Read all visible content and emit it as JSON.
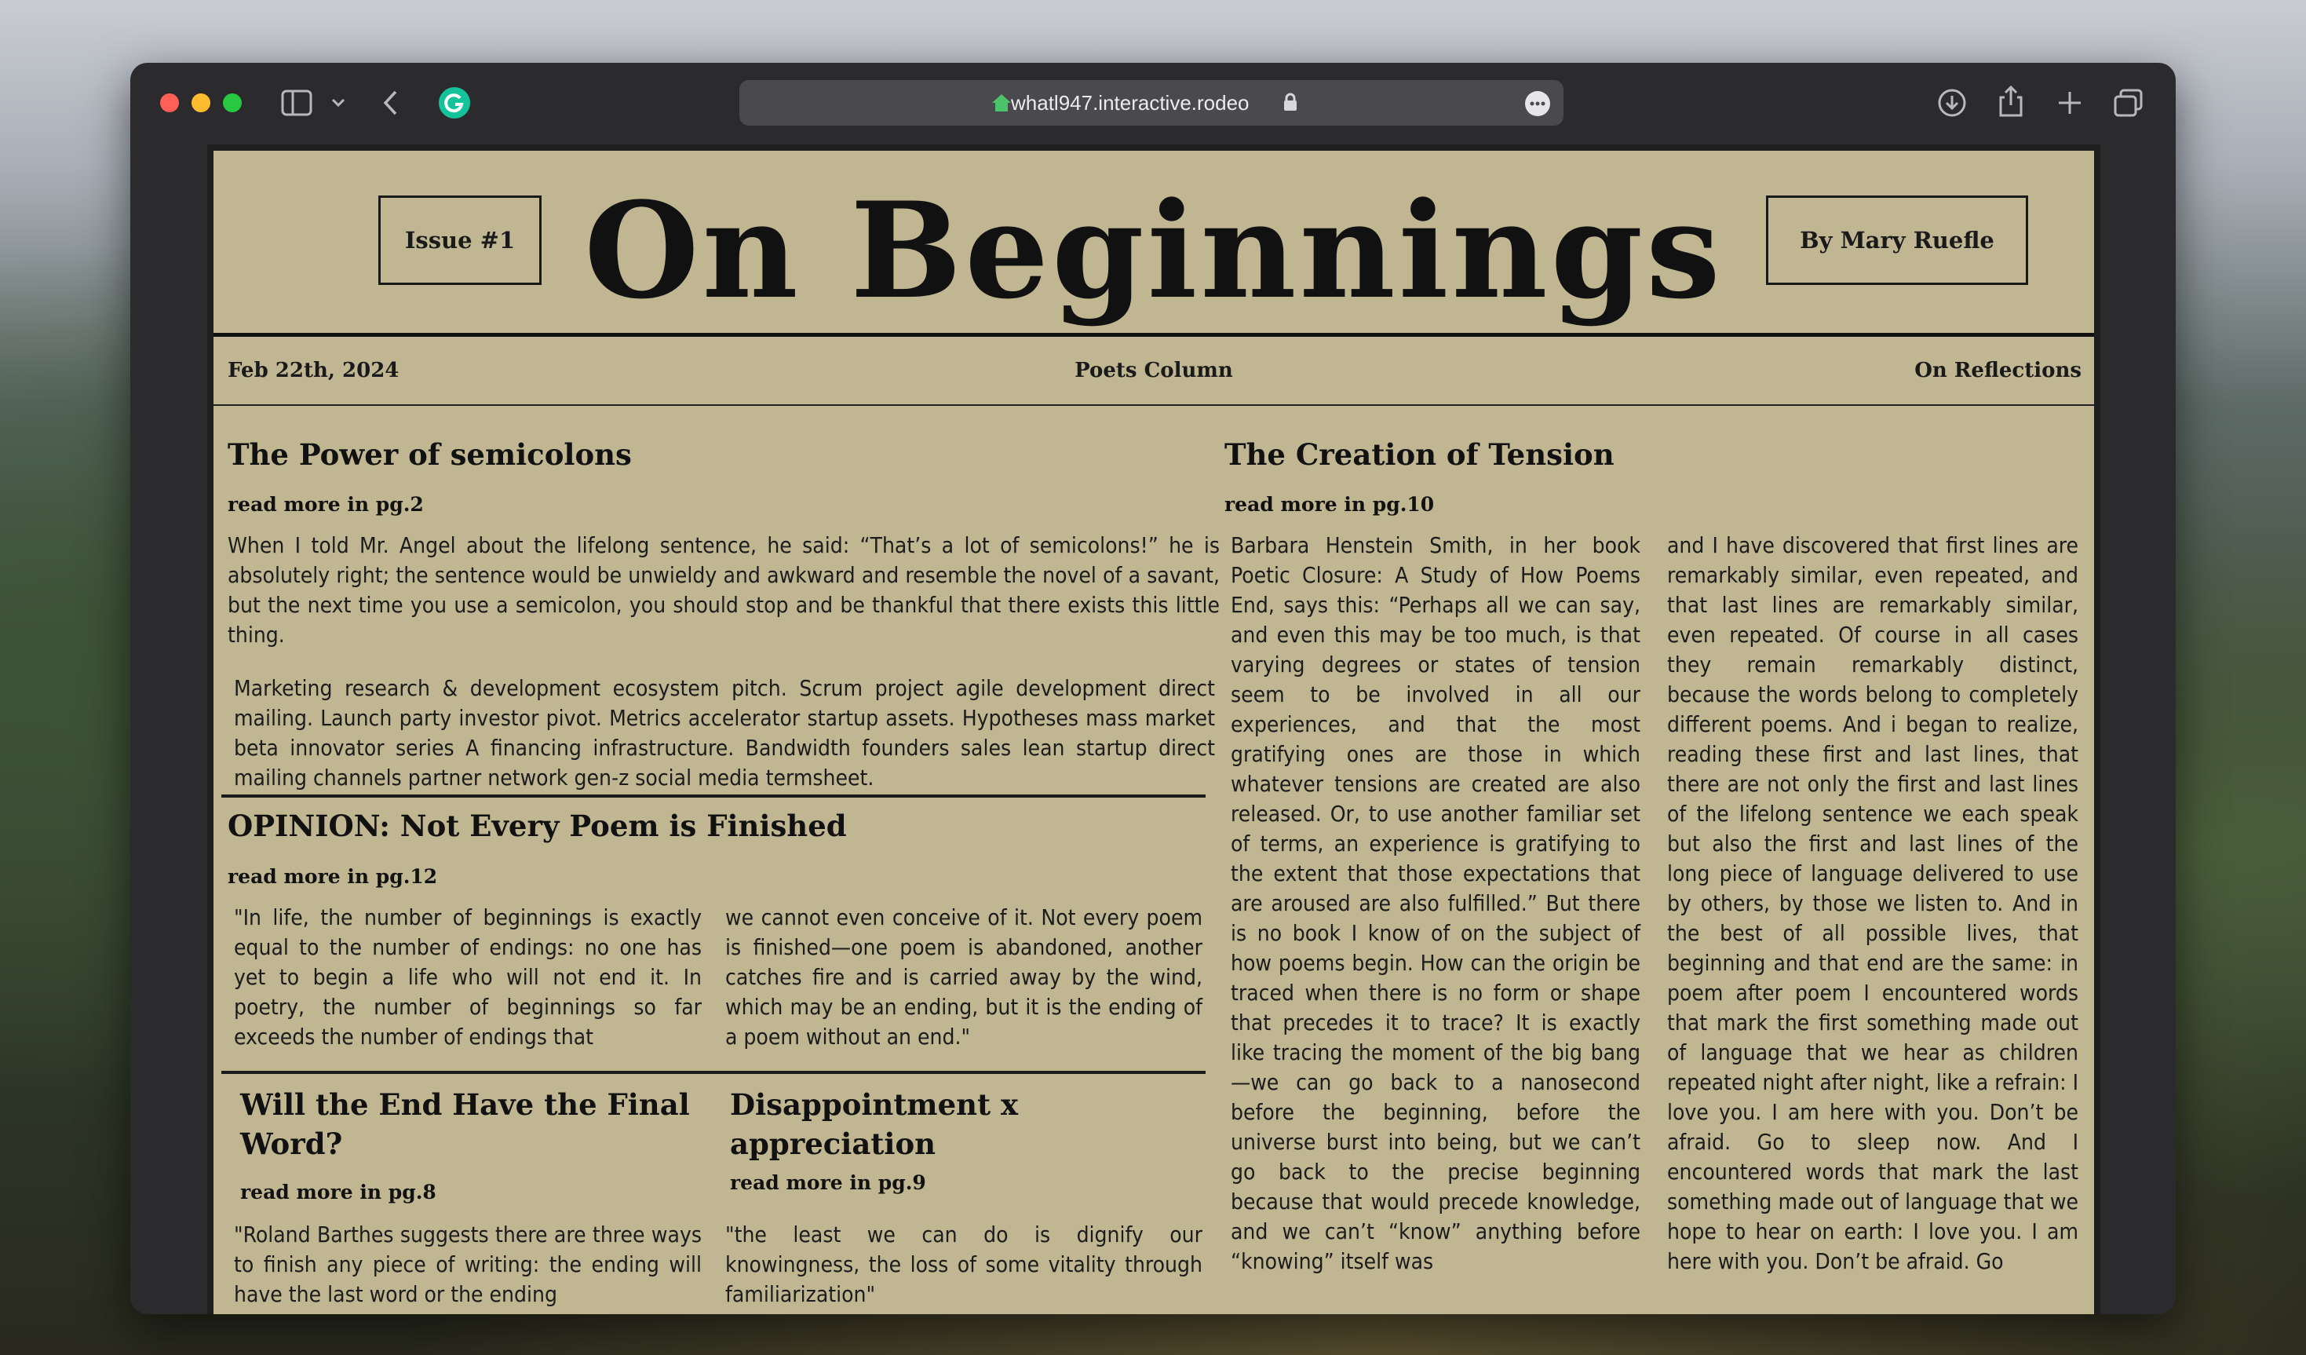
{
  "browser": {
    "url": "whatl947.interactive.rodeo",
    "colors": {
      "close": "#ff5f57",
      "minimize": "#febc2e",
      "zoom": "#28c840"
    }
  },
  "masthead": {
    "issue": "Issue #1",
    "title": "On Beginnings",
    "byline": "By Mary Ruefle"
  },
  "infobar": {
    "date": "Feb 22th, 2024",
    "column": "Poets Column",
    "section": "On Reflections"
  },
  "articles": {
    "semicolons": {
      "headline": "The Power of semicolons",
      "read_more": "read more in pg.2",
      "paragraph1": "When I told Mr. Angel about the lifelong sentence, he said: “That’s a lot of semicolons!” he is absolutely right; the sentence would be unwieldy and awkward and resemble the novel of a savant, but the next time you use a semicolon, you should stop and be thankful that there exists this little thing.",
      "paragraph2": "Marketing research & development ecosystem pitch. Scrum project agile development direct mailing. Launch party investor pivot. Metrics accelerator startup assets. Hypotheses mass market beta innovator series A financing infrastructure. Bandwidth founders sales lean startup direct mailing channels partner network gen-z social media termsheet."
    },
    "opinion": {
      "headline": "OPINION: Not Every Poem is Finished",
      "read_more": "read more in pg.12",
      "col1": "\"In life, the number of beginnings is exactly equal to the number of endings: no one has yet to begin a life who will not end it. In poetry, the number of beginnings so far exceeds the number of endings that",
      "col2": "we cannot even conceive of it. Not every poem is finished—one poem is abandoned, another catches fire and is carried away by the wind, which may be an ending, but it is the ending of a poem without an end.\""
    },
    "final_word": {
      "headline": "Will the End Have the Final Word?",
      "read_more": "read more in pg.8",
      "text": "\"Roland Barthes suggests there are three ways to finish any piece of writing: the ending will have the last word or the ending"
    },
    "disappointment": {
      "headline": "Disappointment x appreciation",
      "read_more": "read more in pg.9",
      "text": "\"the least we can do is dignify our knowingness, the loss of some vitality through familiarization\""
    },
    "tension": {
      "headline": "The Creation of Tension",
      "read_more": "read more in pg.10",
      "col1": "Barbara Henstein Smith, in her book Poetic Closure: A Study of How Poems End, says this: “Perhaps all we can say, and even this may be too much, is that varying degrees or states of tension seem to be involved in all our experiences, and that the most gratifying ones are those in which whatever tensions are created are also released. Or, to use another familiar set of terms, an experience is gratifying to the extent that those expectations that are aroused are also fulfilled.” But there is no book I know of on the subject of how poems begin. How can the origin be traced when there is no form or shape that precedes it to trace? It is exactly like tracing the moment of the big bang—we can go back to a nanosecond before the beginning, before the universe burst into being, but we can’t go back to the precise beginning because that would precede knowledge, and we can’t “know” anything before “knowing” itself was",
      "col2": "and I have discovered that first lines are remarkably similar, even repeated, and that last lines are remarkably similar, even repeated. Of course in all cases they remain remarkably distinct, because the words belong to completely different poems. And i began to realize, reading these first and last lines, that there are not only the first and last lines of the lifelong sentence we each speak but also the first and last lines of the long piece of language delivered to use by others, by those we listen to. And in the best of all possible lives, that beginning and that end are the same: in poem after poem I encountered words that mark the first something made out of language that we hear as children repeated night after night, like a refrain: I love you. I am here with you. Don’t be afraid. Go to sleep now. And I encountered words that mark the last something made out of language that we hope to hear on earth: I love you. I am here with you. Don’t be afraid. Go"
    }
  }
}
